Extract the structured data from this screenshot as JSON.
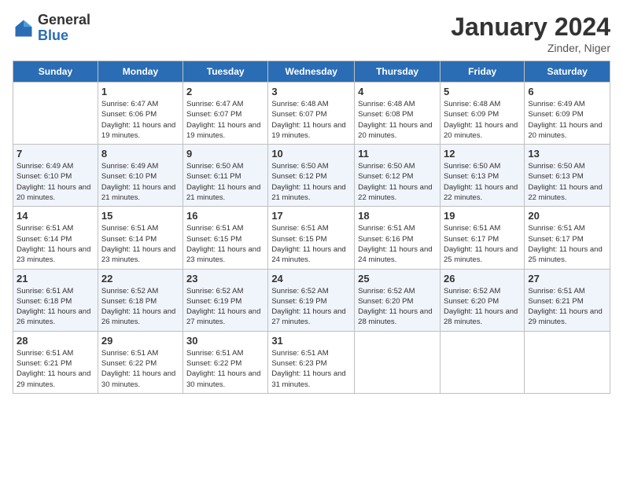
{
  "header": {
    "logo_general": "General",
    "logo_blue": "Blue",
    "title": "January 2024",
    "subtitle": "Zinder, Niger"
  },
  "days_of_week": [
    "Sunday",
    "Monday",
    "Tuesday",
    "Wednesday",
    "Thursday",
    "Friday",
    "Saturday"
  ],
  "weeks": [
    [
      {
        "day": "",
        "detail": ""
      },
      {
        "day": "1",
        "detail": "Sunrise: 6:47 AM\nSunset: 6:06 PM\nDaylight: 11 hours and 19 minutes."
      },
      {
        "day": "2",
        "detail": "Sunrise: 6:47 AM\nSunset: 6:07 PM\nDaylight: 11 hours and 19 minutes."
      },
      {
        "day": "3",
        "detail": "Sunrise: 6:48 AM\nSunset: 6:07 PM\nDaylight: 11 hours and 19 minutes."
      },
      {
        "day": "4",
        "detail": "Sunrise: 6:48 AM\nSunset: 6:08 PM\nDaylight: 11 hours and 20 minutes."
      },
      {
        "day": "5",
        "detail": "Sunrise: 6:48 AM\nSunset: 6:09 PM\nDaylight: 11 hours and 20 minutes."
      },
      {
        "day": "6",
        "detail": "Sunrise: 6:49 AM\nSunset: 6:09 PM\nDaylight: 11 hours and 20 minutes."
      }
    ],
    [
      {
        "day": "7",
        "detail": "Sunrise: 6:49 AM\nSunset: 6:10 PM\nDaylight: 11 hours and 20 minutes."
      },
      {
        "day": "8",
        "detail": "Sunrise: 6:49 AM\nSunset: 6:10 PM\nDaylight: 11 hours and 21 minutes."
      },
      {
        "day": "9",
        "detail": "Sunrise: 6:50 AM\nSunset: 6:11 PM\nDaylight: 11 hours and 21 minutes."
      },
      {
        "day": "10",
        "detail": "Sunrise: 6:50 AM\nSunset: 6:12 PM\nDaylight: 11 hours and 21 minutes."
      },
      {
        "day": "11",
        "detail": "Sunrise: 6:50 AM\nSunset: 6:12 PM\nDaylight: 11 hours and 22 minutes."
      },
      {
        "day": "12",
        "detail": "Sunrise: 6:50 AM\nSunset: 6:13 PM\nDaylight: 11 hours and 22 minutes."
      },
      {
        "day": "13",
        "detail": "Sunrise: 6:50 AM\nSunset: 6:13 PM\nDaylight: 11 hours and 22 minutes."
      }
    ],
    [
      {
        "day": "14",
        "detail": "Sunrise: 6:51 AM\nSunset: 6:14 PM\nDaylight: 11 hours and 23 minutes."
      },
      {
        "day": "15",
        "detail": "Sunrise: 6:51 AM\nSunset: 6:14 PM\nDaylight: 11 hours and 23 minutes."
      },
      {
        "day": "16",
        "detail": "Sunrise: 6:51 AM\nSunset: 6:15 PM\nDaylight: 11 hours and 23 minutes."
      },
      {
        "day": "17",
        "detail": "Sunrise: 6:51 AM\nSunset: 6:15 PM\nDaylight: 11 hours and 24 minutes."
      },
      {
        "day": "18",
        "detail": "Sunrise: 6:51 AM\nSunset: 6:16 PM\nDaylight: 11 hours and 24 minutes."
      },
      {
        "day": "19",
        "detail": "Sunrise: 6:51 AM\nSunset: 6:17 PM\nDaylight: 11 hours and 25 minutes."
      },
      {
        "day": "20",
        "detail": "Sunrise: 6:51 AM\nSunset: 6:17 PM\nDaylight: 11 hours and 25 minutes."
      }
    ],
    [
      {
        "day": "21",
        "detail": "Sunrise: 6:51 AM\nSunset: 6:18 PM\nDaylight: 11 hours and 26 minutes."
      },
      {
        "day": "22",
        "detail": "Sunrise: 6:52 AM\nSunset: 6:18 PM\nDaylight: 11 hours and 26 minutes."
      },
      {
        "day": "23",
        "detail": "Sunrise: 6:52 AM\nSunset: 6:19 PM\nDaylight: 11 hours and 27 minutes."
      },
      {
        "day": "24",
        "detail": "Sunrise: 6:52 AM\nSunset: 6:19 PM\nDaylight: 11 hours and 27 minutes."
      },
      {
        "day": "25",
        "detail": "Sunrise: 6:52 AM\nSunset: 6:20 PM\nDaylight: 11 hours and 28 minutes."
      },
      {
        "day": "26",
        "detail": "Sunrise: 6:52 AM\nSunset: 6:20 PM\nDaylight: 11 hours and 28 minutes."
      },
      {
        "day": "27",
        "detail": "Sunrise: 6:51 AM\nSunset: 6:21 PM\nDaylight: 11 hours and 29 minutes."
      }
    ],
    [
      {
        "day": "28",
        "detail": "Sunrise: 6:51 AM\nSunset: 6:21 PM\nDaylight: 11 hours and 29 minutes."
      },
      {
        "day": "29",
        "detail": "Sunrise: 6:51 AM\nSunset: 6:22 PM\nDaylight: 11 hours and 30 minutes."
      },
      {
        "day": "30",
        "detail": "Sunrise: 6:51 AM\nSunset: 6:22 PM\nDaylight: 11 hours and 30 minutes."
      },
      {
        "day": "31",
        "detail": "Sunrise: 6:51 AM\nSunset: 6:23 PM\nDaylight: 11 hours and 31 minutes."
      },
      {
        "day": "",
        "detail": ""
      },
      {
        "day": "",
        "detail": ""
      },
      {
        "day": "",
        "detail": ""
      }
    ]
  ]
}
